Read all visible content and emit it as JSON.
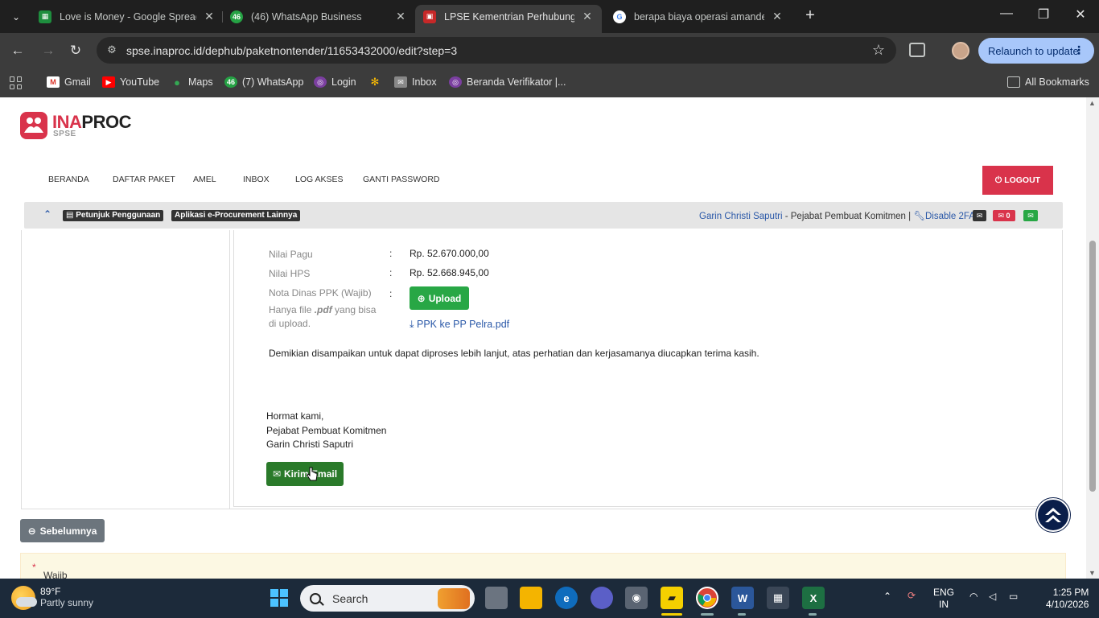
{
  "browser": {
    "tabs": [
      {
        "title": "Love is Money - Google Spread",
        "favicon": "sheets-icon",
        "color": "#1e8e3e"
      },
      {
        "title": "(46) WhatsApp Business",
        "favicon": "whatsapp-icon",
        "color": "#25d366",
        "badge": "46"
      },
      {
        "title": "LPSE Kementrian Perhubungan",
        "favicon": "lpse-icon",
        "color": "#c62828",
        "active": true
      },
      {
        "title": "berapa biaya operasi amandel -",
        "favicon": "google-icon",
        "color": "#4285f4"
      }
    ],
    "url": "spse.inaproc.id/dephub/paketnontender/11653432000/edit?step=3",
    "relaunch_label": "Relaunch to update",
    "bookmarks": [
      {
        "label": "Gmail",
        "icon": "gmail-icon"
      },
      {
        "label": "YouTube",
        "icon": "youtube-icon"
      },
      {
        "label": "Maps",
        "icon": "maps-icon"
      },
      {
        "label": "(7) WhatsApp",
        "icon": "whatsapp-icon",
        "badge": "46"
      },
      {
        "label": "Login",
        "icon": "login-icon"
      },
      {
        "label": "",
        "icon": "photos-icon"
      },
      {
        "label": "Inbox",
        "icon": "mail-icon"
      },
      {
        "label": "Beranda Verifikator |...",
        "icon": "verifikator-icon"
      }
    ],
    "all_bookmarks_label": "All Bookmarks"
  },
  "site": {
    "logo_brand_a": "INA",
    "logo_brand_b": "PROC",
    "logo_sub": "SPSE",
    "nav": [
      "BERANDA",
      "DAFTAR PAKET",
      "AMEL",
      "INBOX",
      "LOG AKSES",
      "GANTI PASSWORD"
    ],
    "logout_label": "LOGOUT",
    "help_label": "Petunjuk Penggunaan",
    "other_apps_label": "Aplikasi e-Procurement Lainnya",
    "user_name": "Garin Christi Saputri",
    "user_role": " - Pejabat Pembuat Komitmen | ",
    "disable_2fa": "Disable 2FA",
    "mail_count": "0"
  },
  "form": {
    "nilai_pagu_label": "Nilai Pagu",
    "nilai_pagu_value": "Rp. 52.670.000,00",
    "nilai_hps_label": "Nilai HPS",
    "nilai_hps_value": "Rp. 52.668.945,00",
    "nota_label": "Nota Dinas PPK (Wajib)",
    "nota_hint_a": "Hanya file ",
    "nota_hint_ext": ".pdf",
    "nota_hint_b": " yang bisa",
    "nota_hint_c": "di upload.",
    "upload_label": "Upload",
    "file_link": "PPK ke PP Pelra.pdf",
    "colon": ":",
    "closing_paragraph": "Demikian disampaikan untuk dapat diproses lebih lanjut, atas perhatian dan kerjasamanya diucapkan terima kasih.",
    "sign_greeting": "Hormat kami,",
    "sign_role": "Pejabat Pembuat Komitmen",
    "sign_name": "Garin Christi Saputri",
    "send_email_label": "Kirim Email",
    "prev_label": "Sebelumnya",
    "required_note": "Wajib diisi."
  },
  "taskbar": {
    "temperature": "89°F",
    "weather": "Partly sunny",
    "search_placeholder": "Search",
    "lang_a": "ENG",
    "lang_b": "IN",
    "time": "1:25 PM",
    "date": "4/10/2026"
  }
}
